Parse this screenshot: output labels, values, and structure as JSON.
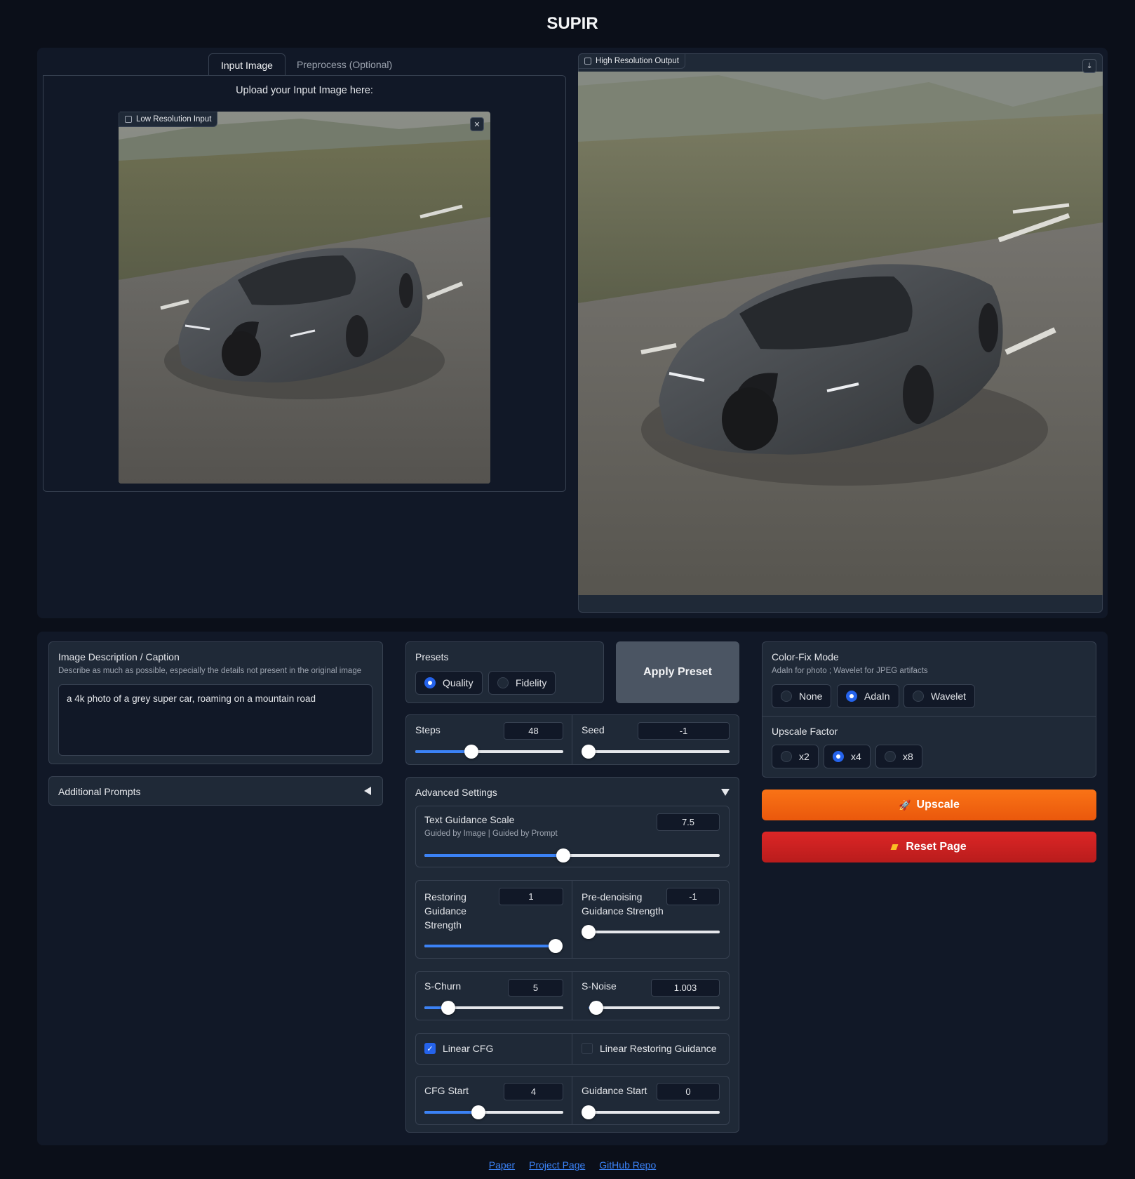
{
  "app": {
    "title": "SUPIR"
  },
  "tabs": [
    {
      "label": "Input Image",
      "selected": true
    },
    {
      "label": "Preprocess (Optional)",
      "selected": false
    }
  ],
  "input_panel": {
    "heading": "Upload your Input Image here:",
    "image_label": "Low Resolution Input",
    "close_icon": "close-icon"
  },
  "output_panel": {
    "image_label": "High Resolution Output",
    "download_icon": "download-icon"
  },
  "caption": {
    "label": "Image Description / Caption",
    "info": "Describe as much as possible, especially the details not present in the original image",
    "value": "a 4k photo of a grey super car, roaming on a mountain road"
  },
  "additional_prompts": {
    "label": "Additional Prompts",
    "icon": "collapse-left-icon"
  },
  "presets": {
    "label": "Presets",
    "options": [
      "Quality",
      "Fidelity"
    ],
    "selected": "Quality",
    "apply_label": "Apply Preset"
  },
  "steps": {
    "label": "Steps",
    "value": "48",
    "fraction": 0.38
  },
  "seed": {
    "label": "Seed",
    "value": "-1",
    "fraction": 0.0
  },
  "advanced": {
    "label": "Advanced Settings",
    "icon": "expand-down-icon",
    "text_guidance": {
      "label": "Text Guidance Scale",
      "info": "Guided by Image | Guided by Prompt",
      "value": "7.5",
      "fraction": 0.47
    },
    "restoring_guidance": {
      "label": "Restoring Guidance Strength",
      "value": "1",
      "fraction": 1.0
    },
    "pre_denoising": {
      "label": "Pre-denoising Guidance Strength",
      "value": "-1",
      "fraction": 0.0
    },
    "s_churn": {
      "label": "S-Churn",
      "value": "5",
      "fraction": 0.17
    },
    "s_noise": {
      "label": "S-Noise",
      "value": "1.003",
      "fraction": 0.06
    },
    "linear_cfg": {
      "label": "Linear CFG",
      "checked": true
    },
    "linear_restoring": {
      "label": "Linear Restoring Guidance",
      "checked": false
    },
    "cfg_start": {
      "label": "CFG Start",
      "value": "4",
      "fraction": 0.39
    },
    "guidance_start": {
      "label": "Guidance Start",
      "value": "0",
      "fraction": 0.0
    }
  },
  "color_fix": {
    "label": "Color-Fix Mode",
    "info": "AdaIn for photo ; Wavelet for JPEG artifacts",
    "options": [
      "None",
      "AdaIn",
      "Wavelet"
    ],
    "selected": "AdaIn"
  },
  "upscale_factor": {
    "label": "Upscale Factor",
    "options": [
      "x2",
      "x4",
      "x8"
    ],
    "selected": "x4"
  },
  "buttons": {
    "upscale": "Upscale",
    "upscale_icon": "rocket-icon",
    "upscale_color": "#f97316",
    "reset": "Reset Page",
    "reset_icon": "broom-icon",
    "reset_color": "#dc2626"
  },
  "footer": {
    "links": [
      "Paper",
      "Project Page",
      "GitHub Repo"
    ]
  },
  "colors": {
    "background": "#0b0f19",
    "panel": "#111827",
    "block": "#1f2937",
    "accent": "#3b82f6"
  }
}
